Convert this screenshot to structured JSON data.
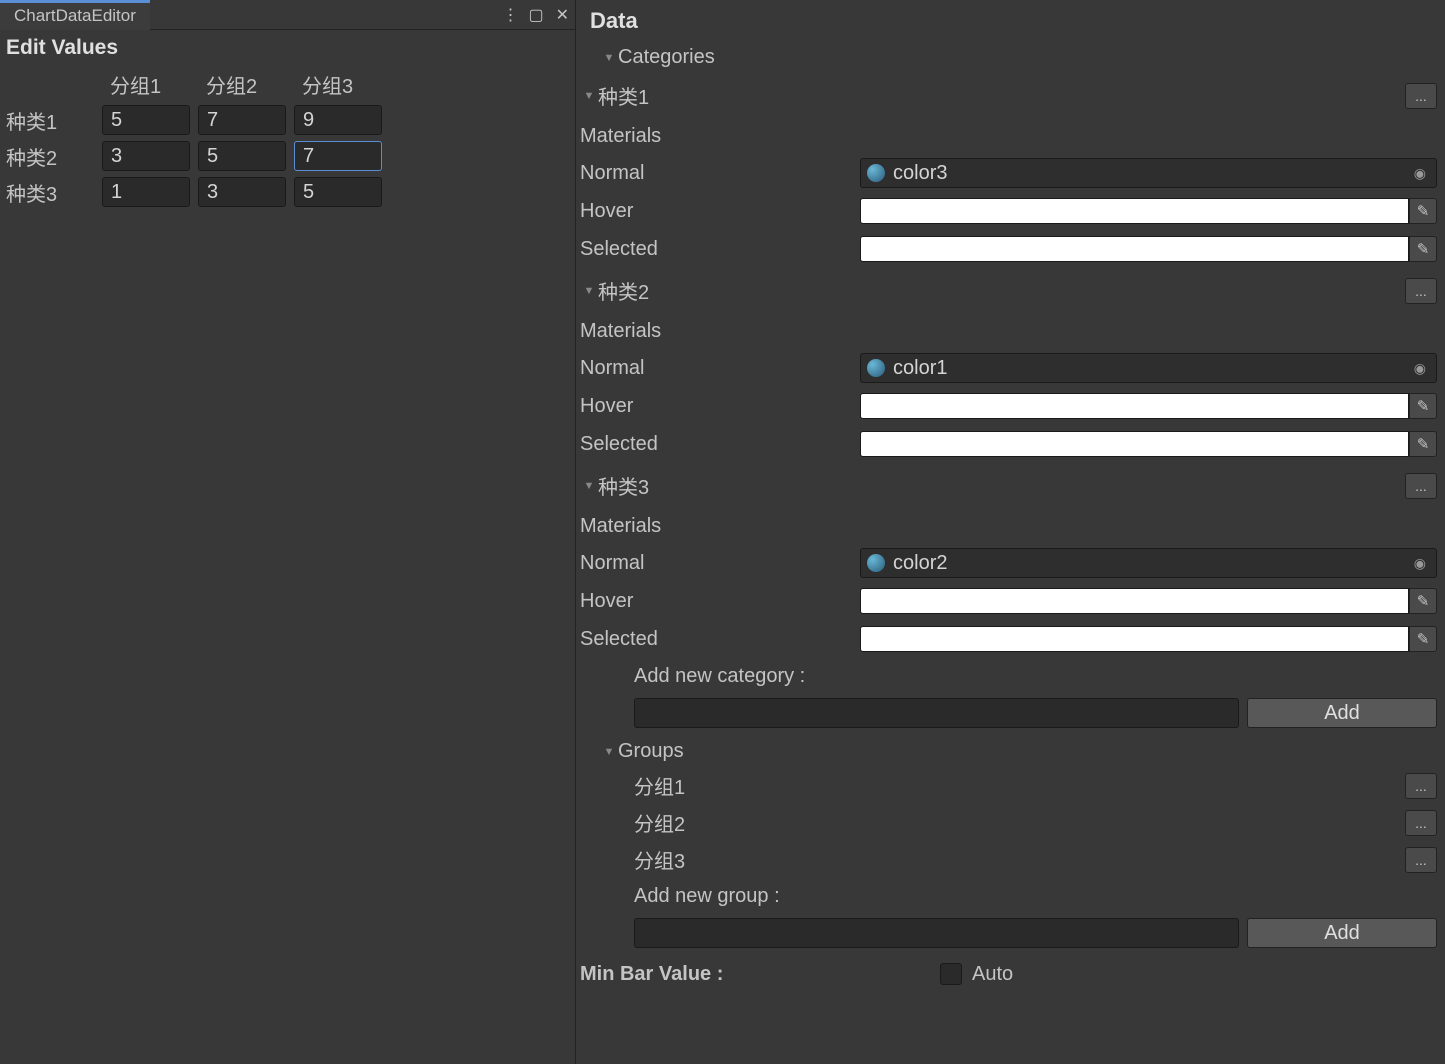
{
  "tab": {
    "title": "ChartDataEditor"
  },
  "editor": {
    "title": "Edit Values",
    "columns": [
      "分组1",
      "分组2",
      "分组3"
    ],
    "rows": [
      {
        "label": "种类1",
        "values": [
          "5",
          "7",
          "9"
        ]
      },
      {
        "label": "种类2",
        "values": [
          "3",
          "5",
          "7"
        ]
      },
      {
        "label": "种类3",
        "values": [
          "1",
          "3",
          "5"
        ]
      }
    ]
  },
  "inspector": {
    "title": "Data",
    "categories_label": "Categories",
    "materials_label": "Materials",
    "normal_label": "Normal",
    "hover_label": "Hover",
    "selected_label": "Selected",
    "categories": [
      {
        "name": "种类1",
        "normal": "color3"
      },
      {
        "name": "种类2",
        "normal": "color1"
      },
      {
        "name": "种类3",
        "normal": "color2"
      }
    ],
    "add_category_label": "Add new category :",
    "add_btn": "Add",
    "groups_label": "Groups",
    "groups": [
      "分组1",
      "分组2",
      "分组3"
    ],
    "add_group_label": "Add new group :",
    "min_bar_label": "Min Bar Value :",
    "auto_label": "Auto"
  }
}
